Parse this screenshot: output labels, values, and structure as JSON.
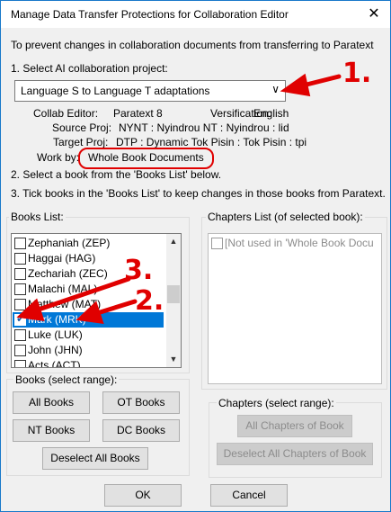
{
  "window": {
    "title": "Manage Data Transfer Protections for Collaboration Editor",
    "close_glyph": "✕"
  },
  "intro": "To prevent changes in collaboration documents from transferring to Paratext",
  "step1": "1. Select AI collaboration project:",
  "project_select": {
    "value": "Language S to Language T adaptations",
    "arrow": "∨"
  },
  "info": {
    "collab_editor_label": "Collab Editor:",
    "collab_editor_value": "Paratext 8",
    "versification_label": "Versification:",
    "versification_value": "English",
    "source_label": "Source Proj:",
    "source_value": "NYNT : Nyindrou NT : Nyindrou : lid",
    "target_label": "Target Proj:",
    "target_value": "DTP : Dynamic Tok Pisin : Tok Pisin : tpi",
    "workby_label": "Work by:",
    "workby_value": "Whole Book Documents"
  },
  "step2": "2. Select a book from the 'Books List' below.",
  "step3": "3. Tick books in the 'Books List' to keep changes in those books from Paratext.",
  "books_list": {
    "label": "Books List:",
    "items": [
      {
        "label": "Zephaniah (ZEP)",
        "checked": false,
        "selected": false
      },
      {
        "label": "Haggai (HAG)",
        "checked": false,
        "selected": false
      },
      {
        "label": "Zechariah (ZEC)",
        "checked": false,
        "selected": false
      },
      {
        "label": "Malachi (MAL)",
        "checked": false,
        "selected": false
      },
      {
        "label": "Matthew (MAT)",
        "checked": false,
        "selected": false
      },
      {
        "label": "Mark (MRK)",
        "checked": true,
        "selected": true
      },
      {
        "label": "Luke (LUK)",
        "checked": false,
        "selected": false
      },
      {
        "label": "John (JHN)",
        "checked": false,
        "selected": false
      },
      {
        "label": "Acts (ACT)",
        "checked": false,
        "selected": false
      }
    ]
  },
  "chapters_list": {
    "label": "Chapters List (of selected book):",
    "item": "[Not used in 'Whole Book Docu"
  },
  "books_range": {
    "label": "Books (select range):",
    "all_books": "All Books",
    "ot_books": "OT Books",
    "nt_books": "NT Books",
    "dc_books": "DC Books",
    "deselect_all": "Deselect All Books"
  },
  "chapters_range": {
    "label": "Chapters (select range):",
    "all_chapters": "All Chapters of Book",
    "deselect_all": "Deselect All Chapters of Book"
  },
  "footer": {
    "ok": "OK",
    "cancel": "Cancel"
  },
  "annotations": {
    "one": "1.",
    "two": "2.",
    "three": "3.",
    "color": "#e00000"
  }
}
